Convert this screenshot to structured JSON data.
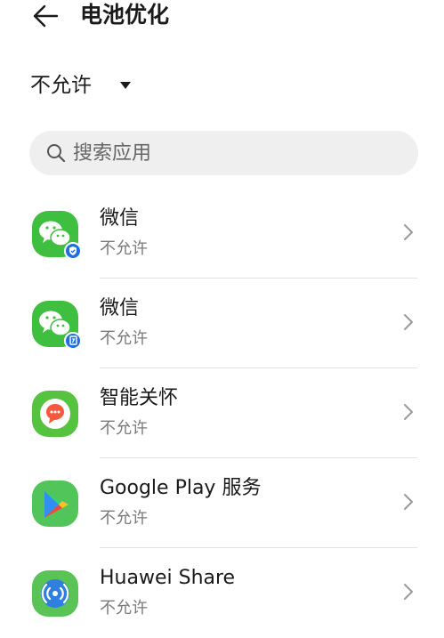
{
  "header": {
    "title": "电池优化"
  },
  "filter": {
    "label": "不允许"
  },
  "search": {
    "placeholder": "搜索应用"
  },
  "apps": [
    {
      "name": "微信",
      "status": "不允许",
      "icon": "wechat-icon",
      "badge": "verified-badge-icon"
    },
    {
      "name": "微信",
      "status": "不允许",
      "icon": "wechat-icon",
      "badge": "clone-badge-icon"
    },
    {
      "name": "智能关怀",
      "status": "不允许",
      "icon": "smart-care-icon"
    },
    {
      "name": "Google Play 服务",
      "status": "不允许",
      "icon": "google-play-services-icon"
    },
    {
      "name": "Huawei Share",
      "status": "不允许",
      "icon": "huawei-share-icon"
    }
  ],
  "colors": {
    "accent": "#1e6fde",
    "wechat_green": "#3fbf3f",
    "search_bg": "#efefef"
  }
}
